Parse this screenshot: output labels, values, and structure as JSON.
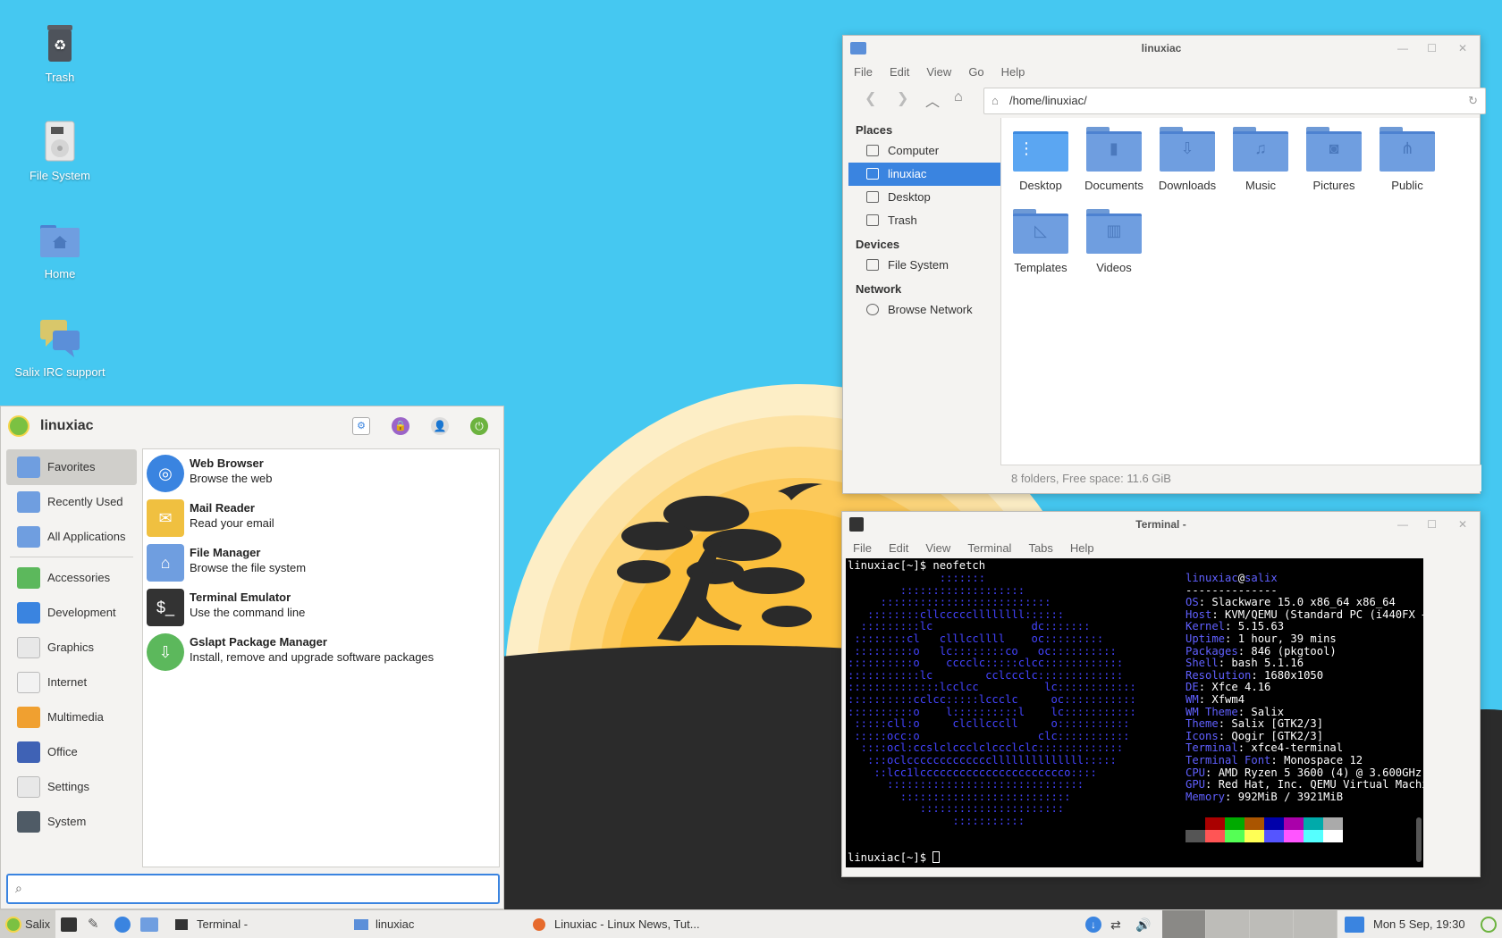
{
  "desktop": {
    "icons": [
      {
        "label": "Trash",
        "icon": "trash-icon"
      },
      {
        "label": "File System",
        "icon": "drive-icon"
      },
      {
        "label": "Home",
        "icon": "home-folder-icon"
      },
      {
        "label": "Salix IRC support",
        "icon": "chat-icon"
      }
    ]
  },
  "file_manager": {
    "title": "linuxiac",
    "menu": [
      "File",
      "Edit",
      "View",
      "Go",
      "Help"
    ],
    "path": "/home/linuxiac/",
    "places_header": "Places",
    "places": [
      "Computer",
      "linuxiac",
      "Desktop",
      "Trash"
    ],
    "devices_header": "Devices",
    "devices": [
      "File System"
    ],
    "network_header": "Network",
    "network": [
      "Browse Network"
    ],
    "folders": [
      "Desktop",
      "Documents",
      "Downloads",
      "Music",
      "Pictures",
      "Public",
      "Templates",
      "Videos"
    ],
    "status": "8 folders, Free space: 11.6 GiB"
  },
  "terminal": {
    "title": "Terminal -",
    "menu": [
      "File",
      "Edit",
      "View",
      "Terminal",
      "Tabs",
      "Help"
    ],
    "command_line": "linuxiac[~]$ neofetch",
    "prompt": "linuxiac[~]$ ",
    "user": "linuxiac",
    "at": "@",
    "host": "salix",
    "separator": "--------------",
    "info": [
      {
        "key": "OS",
        "value": "Slackware 15.0 x86_64 x86_64"
      },
      {
        "key": "Host",
        "value": "KVM/QEMU (Standard PC (i440FX +"
      },
      {
        "key": "Kernel",
        "value": "5.15.63"
      },
      {
        "key": "Uptime",
        "value": "1 hour, 39 mins"
      },
      {
        "key": "Packages",
        "value": "846 (pkgtool)"
      },
      {
        "key": "Shell",
        "value": "bash 5.1.16"
      },
      {
        "key": "Resolution",
        "value": "1680x1050"
      },
      {
        "key": "DE",
        "value": "Xfce 4.16"
      },
      {
        "key": "WM",
        "value": "Xfwm4"
      },
      {
        "key": "WM Theme",
        "value": "Salix"
      },
      {
        "key": "Theme",
        "value": "Salix [GTK2/3]"
      },
      {
        "key": "Icons",
        "value": "Qogir [GTK2/3]"
      },
      {
        "key": "Terminal",
        "value": "xfce4-terminal"
      },
      {
        "key": "Terminal Font",
        "value": "Monospace 12"
      },
      {
        "key": "CPU",
        "value": "AMD Ryzen 5 3600 (4) @ 3.600GHz"
      },
      {
        "key": "GPU",
        "value": "Red Hat, Inc. QEMU Virtual Machin"
      },
      {
        "key": "Memory",
        "value": "992MiB / 3921MiB"
      }
    ],
    "logo_lines": [
      "              :::::::",
      "        :::::::::::::::::::",
      "     ::::::::::::::::::::::::::",
      "   ::::::::cllcccccllllllll::::::",
      "  :::::::::lc               dc:::::::",
      " ::::::::cl   clllccllll    oc:::::::::",
      " :::::::::o   lc::::::::co   oc::::::::::",
      "::::::::::o    cccclc:::::clcc::::::::::::",
      ":::::::::::lc        cclccclc:::::::::::::",
      "::::::::::::::lcclcc          lc::::::::::::",
      "::::::::::cclcc:::::lccclc     oc:::::::::::",
      "::::::::::o    l::::::::::l    lc:::::::::::",
      " :::::cll:o     clcllcccll     o:::::::::::",
      " :::::occ:o                  clc:::::::::::",
      "  ::::ocl:ccslclccclclccclclc:::::::::::::",
      "   :::oclcccccccccccccllllllllllllll:::::",
      "    ::lcc1lcccccccccccccccccccccco::::",
      "      ::::::::::::::::::::::::::::::",
      "        ::::::::::::::::::::::::::",
      "           ::::::::::::::::::::::",
      "                :::::::::::"
    ],
    "colors_top": [
      "#000000",
      "#aa0000",
      "#00aa00",
      "#aa5500",
      "#0000aa",
      "#aa00aa",
      "#00aaaa",
      "#aaaaaa"
    ],
    "colors_bottom": [
      "#555555",
      "#ff5555",
      "#55ff55",
      "#ffff55",
      "#5555ff",
      "#ff55ff",
      "#55ffff",
      "#ffffff"
    ]
  },
  "whisker_menu": {
    "username": "linuxiac",
    "categories": [
      {
        "label": "Favorites",
        "selected": true,
        "icon": "star-folder-icon"
      },
      {
        "label": "Recently Used",
        "icon": "clock-folder-icon"
      },
      {
        "label": "All Applications",
        "icon": "apps-folder-icon"
      },
      {
        "label": "Accessories",
        "icon": "accessories-icon"
      },
      {
        "label": "Development",
        "icon": "development-icon"
      },
      {
        "label": "Graphics",
        "icon": "graphics-icon"
      },
      {
        "label": "Internet",
        "icon": "internet-icon"
      },
      {
        "label": "Multimedia",
        "icon": "multimedia-icon"
      },
      {
        "label": "Office",
        "icon": "office-icon"
      },
      {
        "label": "Settings",
        "icon": "settings-icon"
      },
      {
        "label": "System",
        "icon": "system-icon"
      }
    ],
    "apps": [
      {
        "name": "Web Browser",
        "desc": "Browse the web",
        "icon": "web-browser-icon"
      },
      {
        "name": "Mail Reader",
        "desc": "Read your email",
        "icon": "mail-icon"
      },
      {
        "name": "File Manager",
        "desc": "Browse the file system",
        "icon": "file-manager-icon"
      },
      {
        "name": "Terminal Emulator",
        "desc": "Use the command line",
        "icon": "terminal-icon"
      },
      {
        "name": "Gslapt Package Manager",
        "desc": "Install, remove and upgrade software packages",
        "icon": "package-manager-icon"
      }
    ],
    "search_value": ""
  },
  "taskbar": {
    "start_label": "Salix",
    "tasks": [
      {
        "label": "Terminal -"
      },
      {
        "label": "linuxiac"
      },
      {
        "label": "Linuxiac - Linux News, Tut..."
      }
    ],
    "clock": "Mon  5 Sep, 19:30"
  }
}
